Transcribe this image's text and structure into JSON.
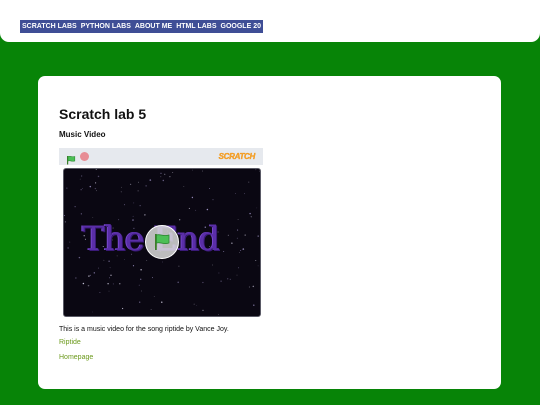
{
  "nav": {
    "items": [
      "SCRATCH LABS",
      "PYTHON LABS",
      "ABOUT ME",
      "HTML LABS",
      "GOOGLE 20"
    ]
  },
  "page": {
    "title": "Scratch lab 5",
    "subtitle": "Music Video",
    "description": "This is a music video for the song riptide by Vance Joy.",
    "links": [
      "Riptide",
      "Homepage"
    ]
  },
  "player": {
    "logo_text": "SCRATCH",
    "stage_text": "The End",
    "icons": [
      "green-flag-icon",
      "stop-icon",
      "green-flag-play-icon"
    ]
  },
  "colors": {
    "background": "#078407",
    "nav_bg": "#3f4e96",
    "link": "#6c9a1c",
    "stage_bg": "#0a0712",
    "stage_text": "#5a2ea8"
  }
}
